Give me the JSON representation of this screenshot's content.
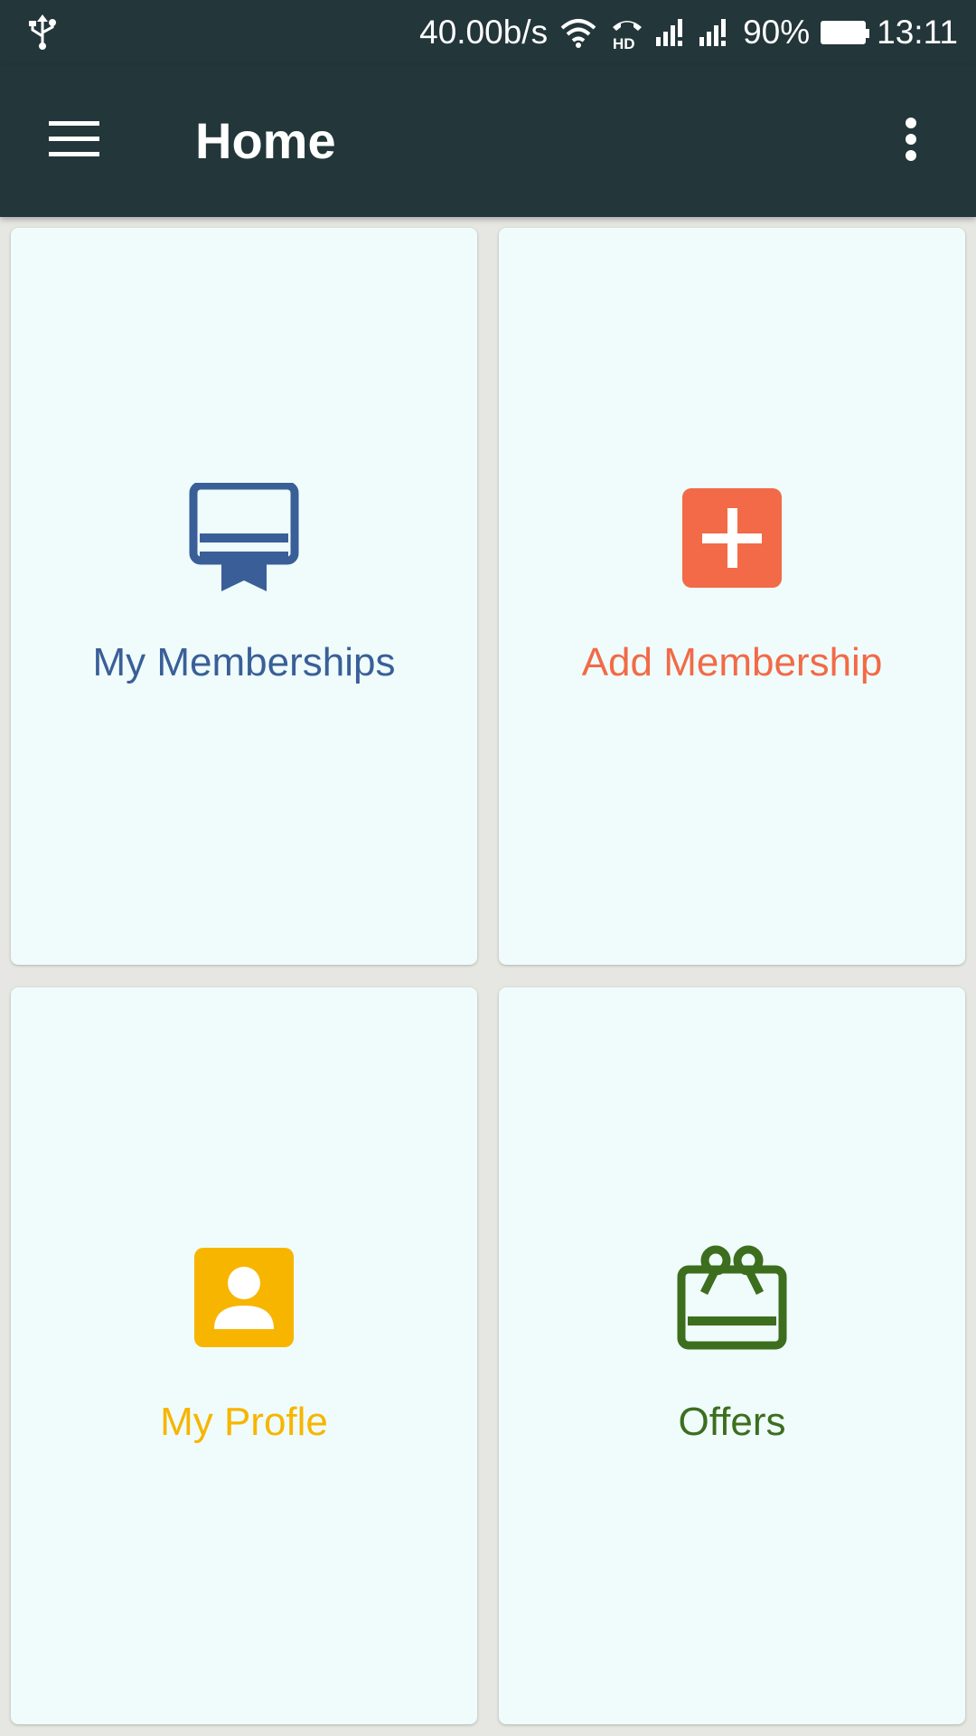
{
  "status_bar": {
    "network_speed": "40.00b/s",
    "battery_percent": "90%",
    "battery_level": 0.9,
    "time": "13:11",
    "icons": [
      "usb-icon",
      "wifi-icon",
      "hd-call-icon",
      "signal-1-icon",
      "signal-2-icon",
      "battery-icon"
    ],
    "hd_text": "HD"
  },
  "app_bar": {
    "title": "Home",
    "menu_icon": "hamburger-menu-icon",
    "overflow_icon": "more-vert-icon"
  },
  "tiles": [
    {
      "label": "My Memberships",
      "icon": "membership-card-icon",
      "color": "#3a5f98"
    },
    {
      "label": "Add Membership",
      "icon": "add-box-icon",
      "color": "#f26a47"
    },
    {
      "label": "My Profle",
      "icon": "account-box-icon",
      "color": "#f7b500"
    },
    {
      "label": "Offers",
      "icon": "gift-card-icon",
      "color": "#3c6e1e"
    }
  ],
  "colors": {
    "app_bar": "#23363a",
    "card_background": "#effcfb",
    "page_background": "#e6e6e2"
  }
}
